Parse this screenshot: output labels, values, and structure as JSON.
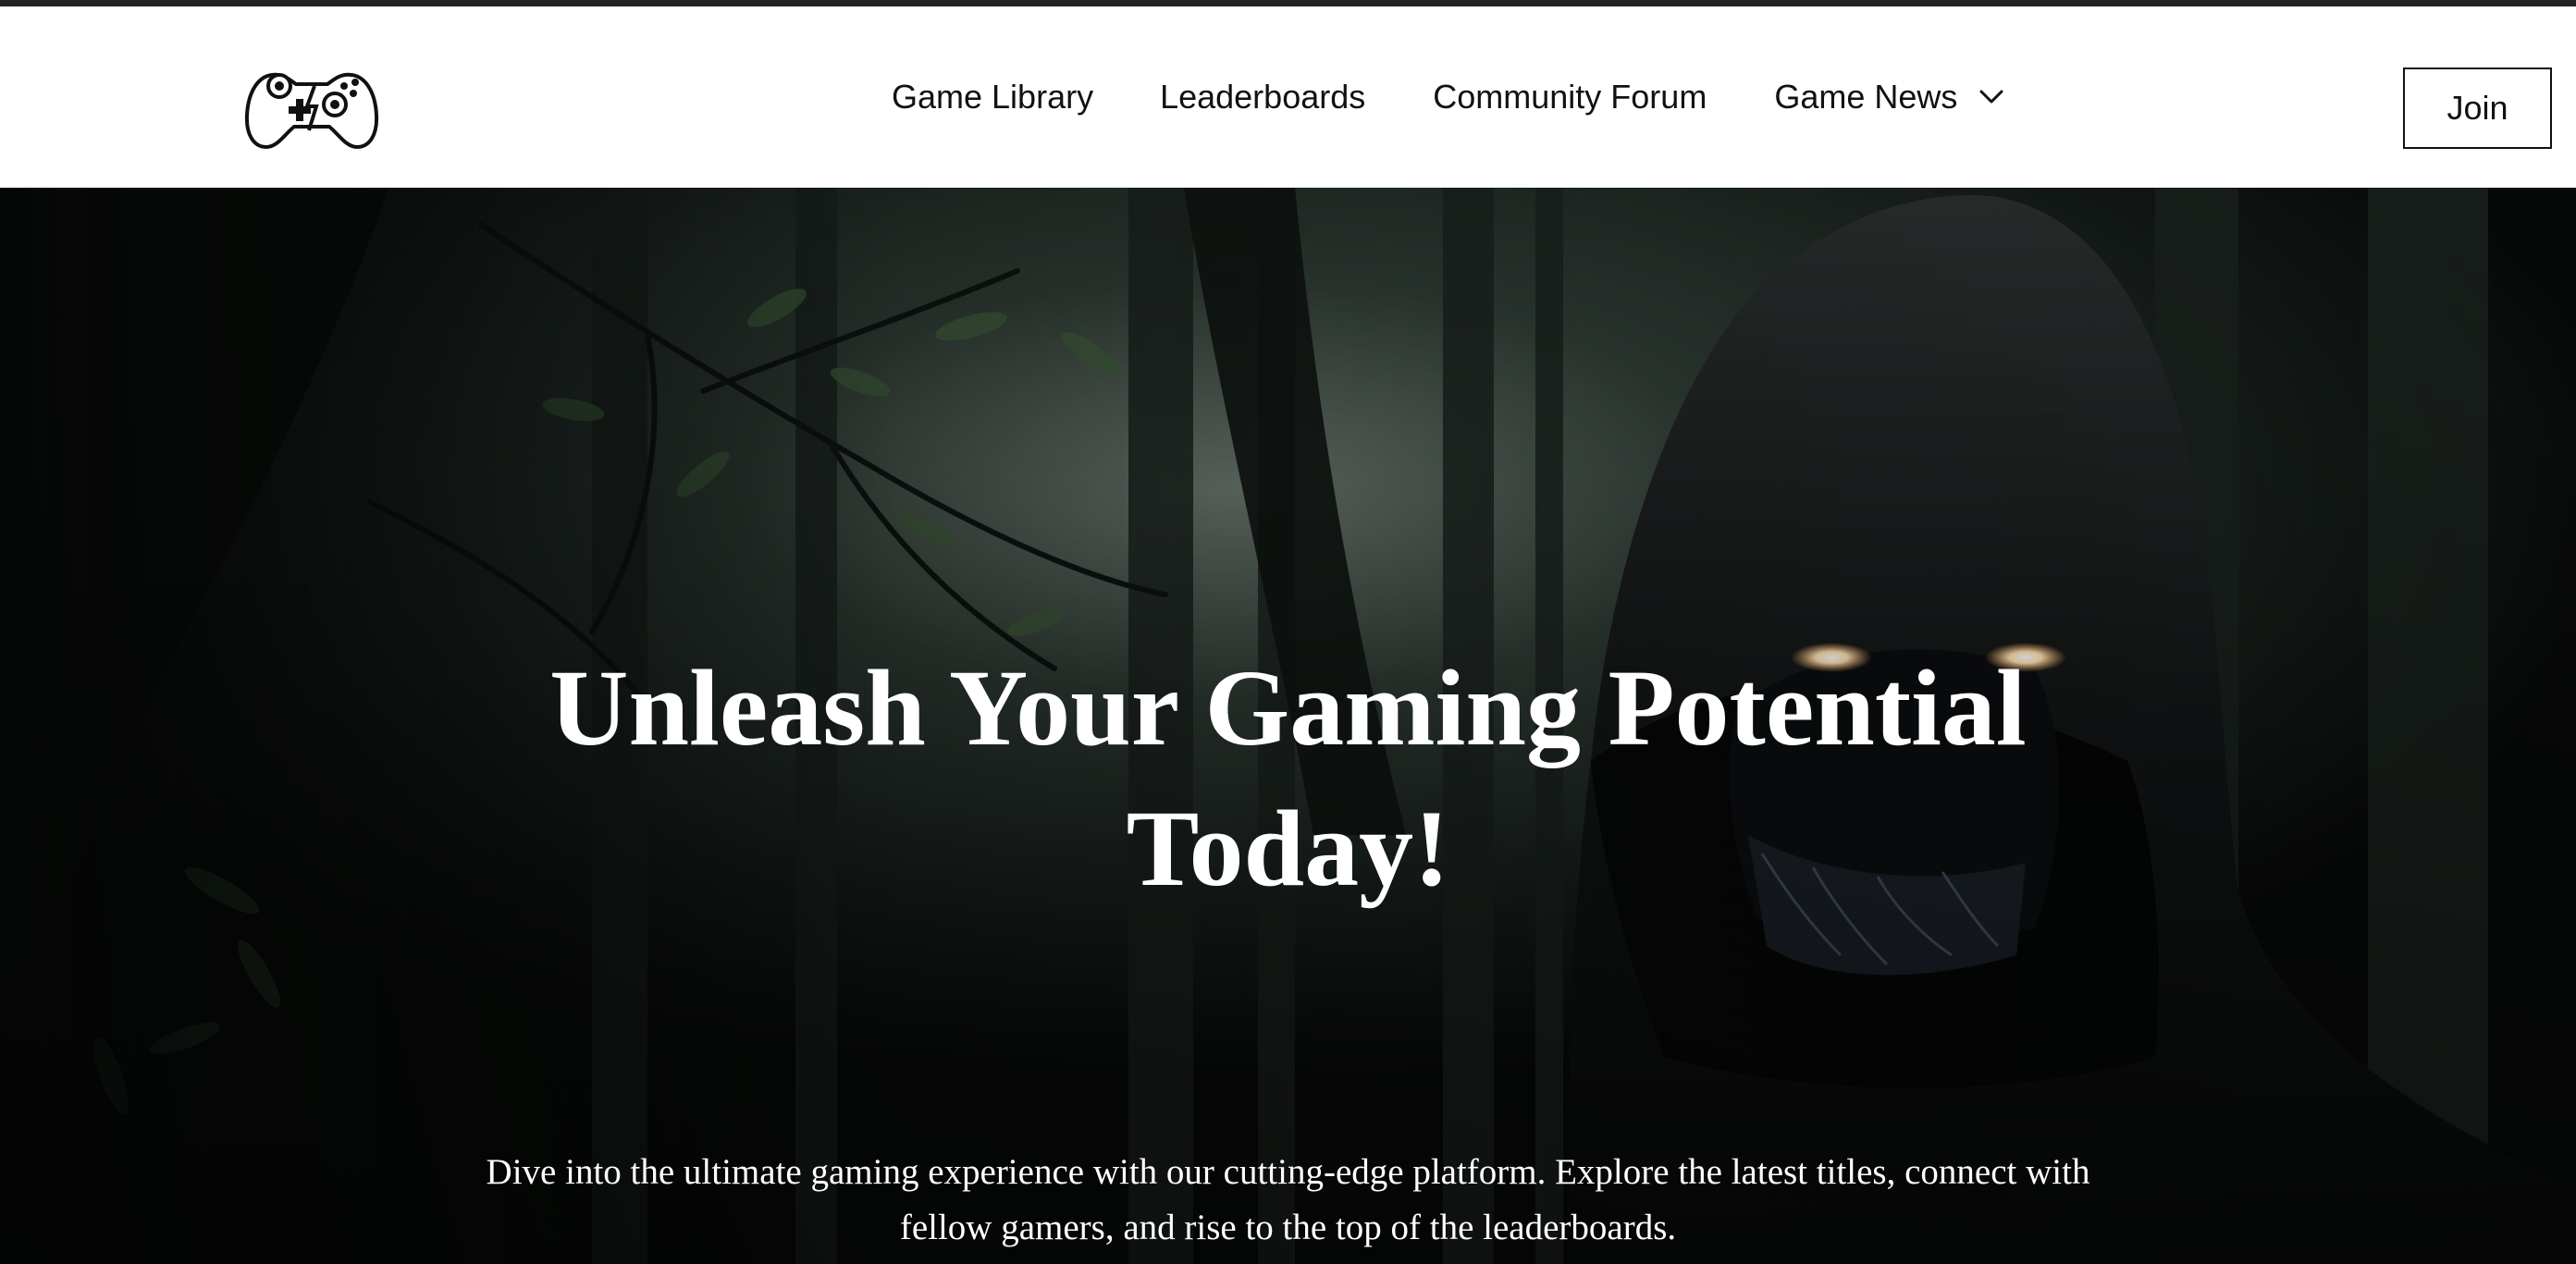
{
  "header": {
    "logo_icon": "game-controller-icon",
    "nav": {
      "game_library": "Game Library",
      "leaderboards": "Leaderboards",
      "community_forum": "Community Forum",
      "game_news": "Game News",
      "game_news_icon": "chevron-down-icon"
    },
    "join_label": "Join"
  },
  "hero": {
    "background": "dark-forest-hooded-figure-image",
    "title": "Unleash Your Gaming Potential Today!",
    "subtitle": "Dive into the ultimate gaming experience with our cutting-edge platform. Explore the latest titles, connect with fellow gamers, and rise to the top of the leaderboards."
  },
  "colors": {
    "top_strip": "#222326",
    "text_dark": "#111111",
    "hero_text": "#ffffff",
    "hero_bg": "#0b0d0c"
  }
}
